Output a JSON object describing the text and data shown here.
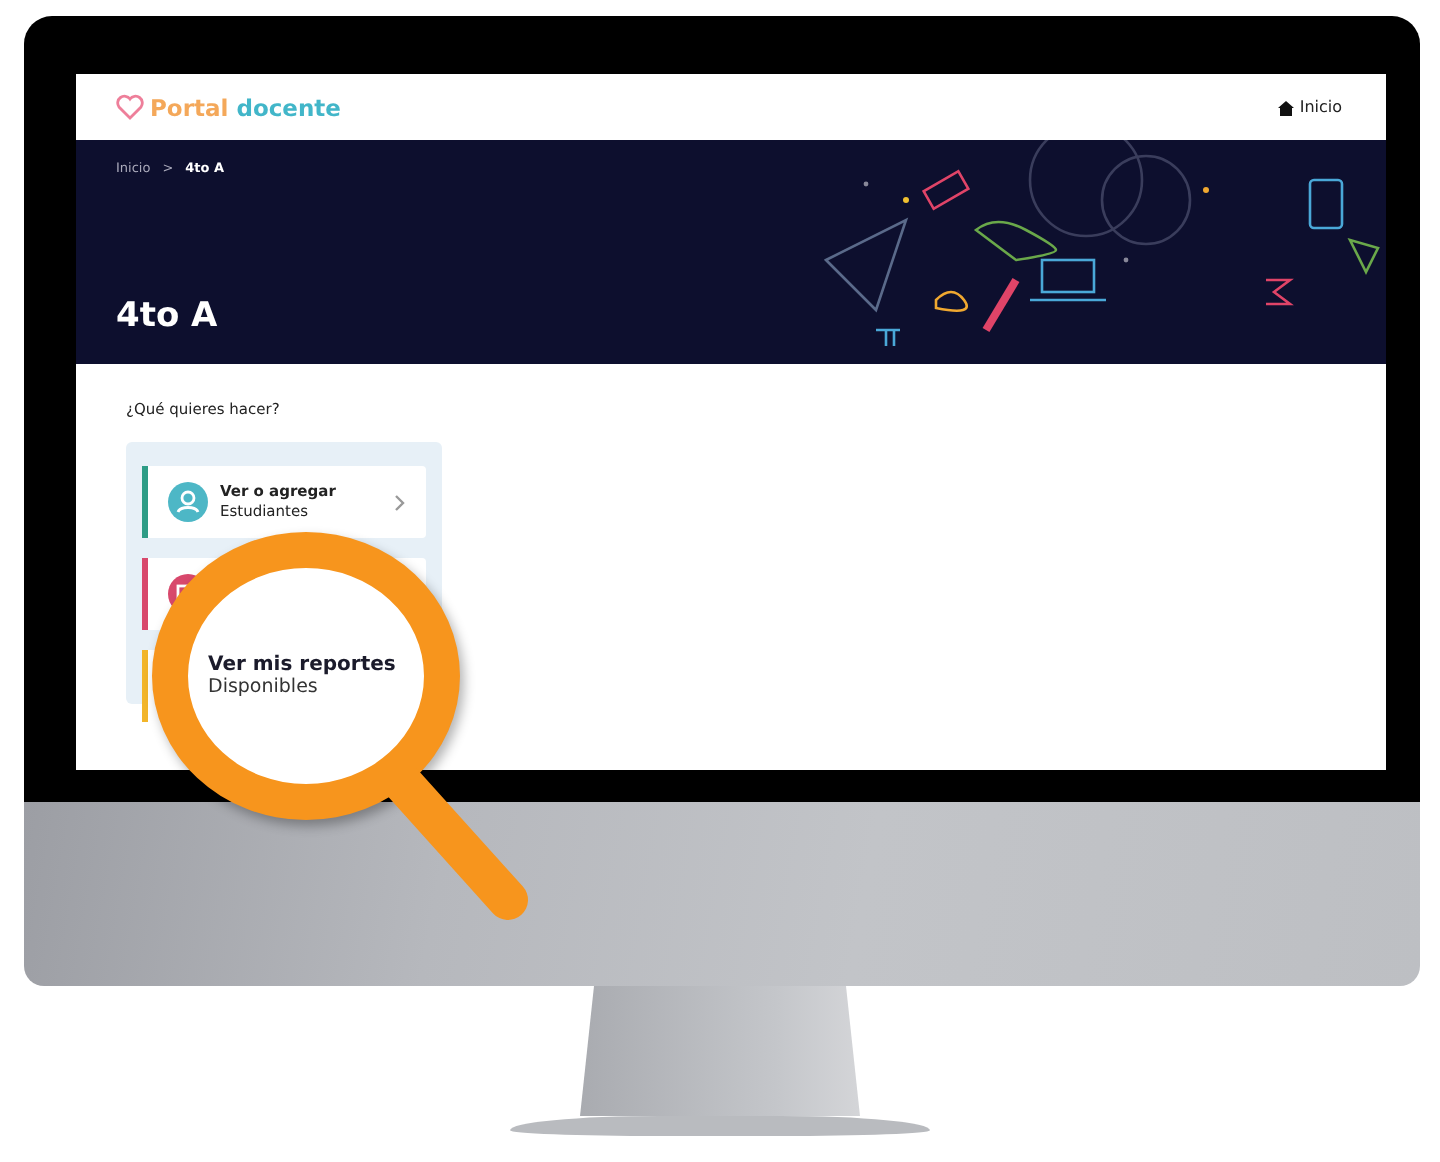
{
  "header": {
    "logo": {
      "part_1": "Portal",
      "part_2": "docente"
    },
    "nav_link": "Inicio"
  },
  "banner": {
    "breadcrumb": [
      {
        "label": "Inicio",
        "selected": false
      },
      {
        "label": "4to A",
        "selected": true
      }
    ],
    "separator": ">",
    "title": "4to A"
  },
  "prompt": "¿Qué quieres hacer?",
  "cards": [
    {
      "kind": "students",
      "color": "#2e9c86",
      "title": "Ver o agregar",
      "subtitle": "Estudiantes"
    },
    {
      "kind": "calendar",
      "color": "#d8486c"
    },
    {
      "kind": "reports",
      "color": "#f2b52a"
    }
  ],
  "magnifier": {
    "title": "Ver mis reportes",
    "subtitle": "Disponibles"
  }
}
